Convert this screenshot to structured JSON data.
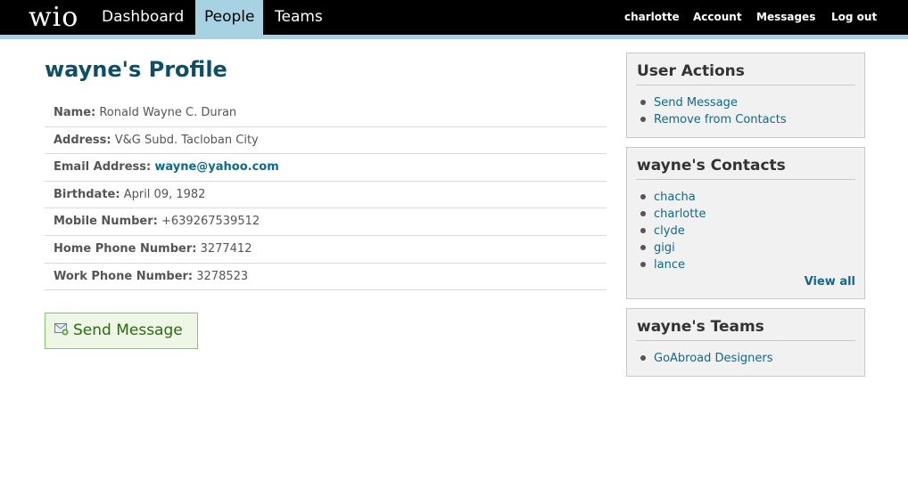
{
  "header": {
    "logo": "wio",
    "tabs": [
      {
        "label": "Dashboard",
        "active": false
      },
      {
        "label": "People",
        "active": true
      },
      {
        "label": "Teams",
        "active": false
      }
    ],
    "user_links": [
      "charlotte",
      "Account",
      "Messages",
      "Log out"
    ]
  },
  "colors": {
    "topbar": "#000000",
    "accent": "#a6d2e2",
    "title": "#0d4f67",
    "link": "#0e6a8a",
    "button_bg": "#eef7e6",
    "button_border": "#8cc46a",
    "button_text": "#2d6a0f"
  },
  "profile": {
    "title": "wayne's Profile",
    "fields": [
      {
        "label": "Name:",
        "value": "Ronald Wayne C. Duran",
        "link": false
      },
      {
        "label": "Address:",
        "value": "V&G Subd. Tacloban City",
        "link": false
      },
      {
        "label": "Email Address:",
        "value": "wayne@yahoo.com",
        "link": true
      },
      {
        "label": "Birthdate:",
        "value": "April 09, 1982",
        "link": false
      },
      {
        "label": "Mobile Number:",
        "value": "+639267539512",
        "link": false
      },
      {
        "label": "Home Phone Number:",
        "value": "3277412",
        "link": false
      },
      {
        "label": "Work Phone Number:",
        "value": "3278523",
        "link": false
      }
    ],
    "send_button": {
      "label": "Send Message",
      "icon": "envelope-plus-icon"
    }
  },
  "sidebar": {
    "user_actions": {
      "title": "User Actions",
      "items": [
        "Send Message",
        "Remove from Contacts"
      ]
    },
    "contacts": {
      "title": "wayne's Contacts",
      "items": [
        "chacha",
        "charlotte",
        "clyde",
        "gigi",
        "lance"
      ],
      "view_all": "View all"
    },
    "teams": {
      "title": "wayne's Teams",
      "items": [
        "GoAbroad Designers"
      ]
    }
  }
}
